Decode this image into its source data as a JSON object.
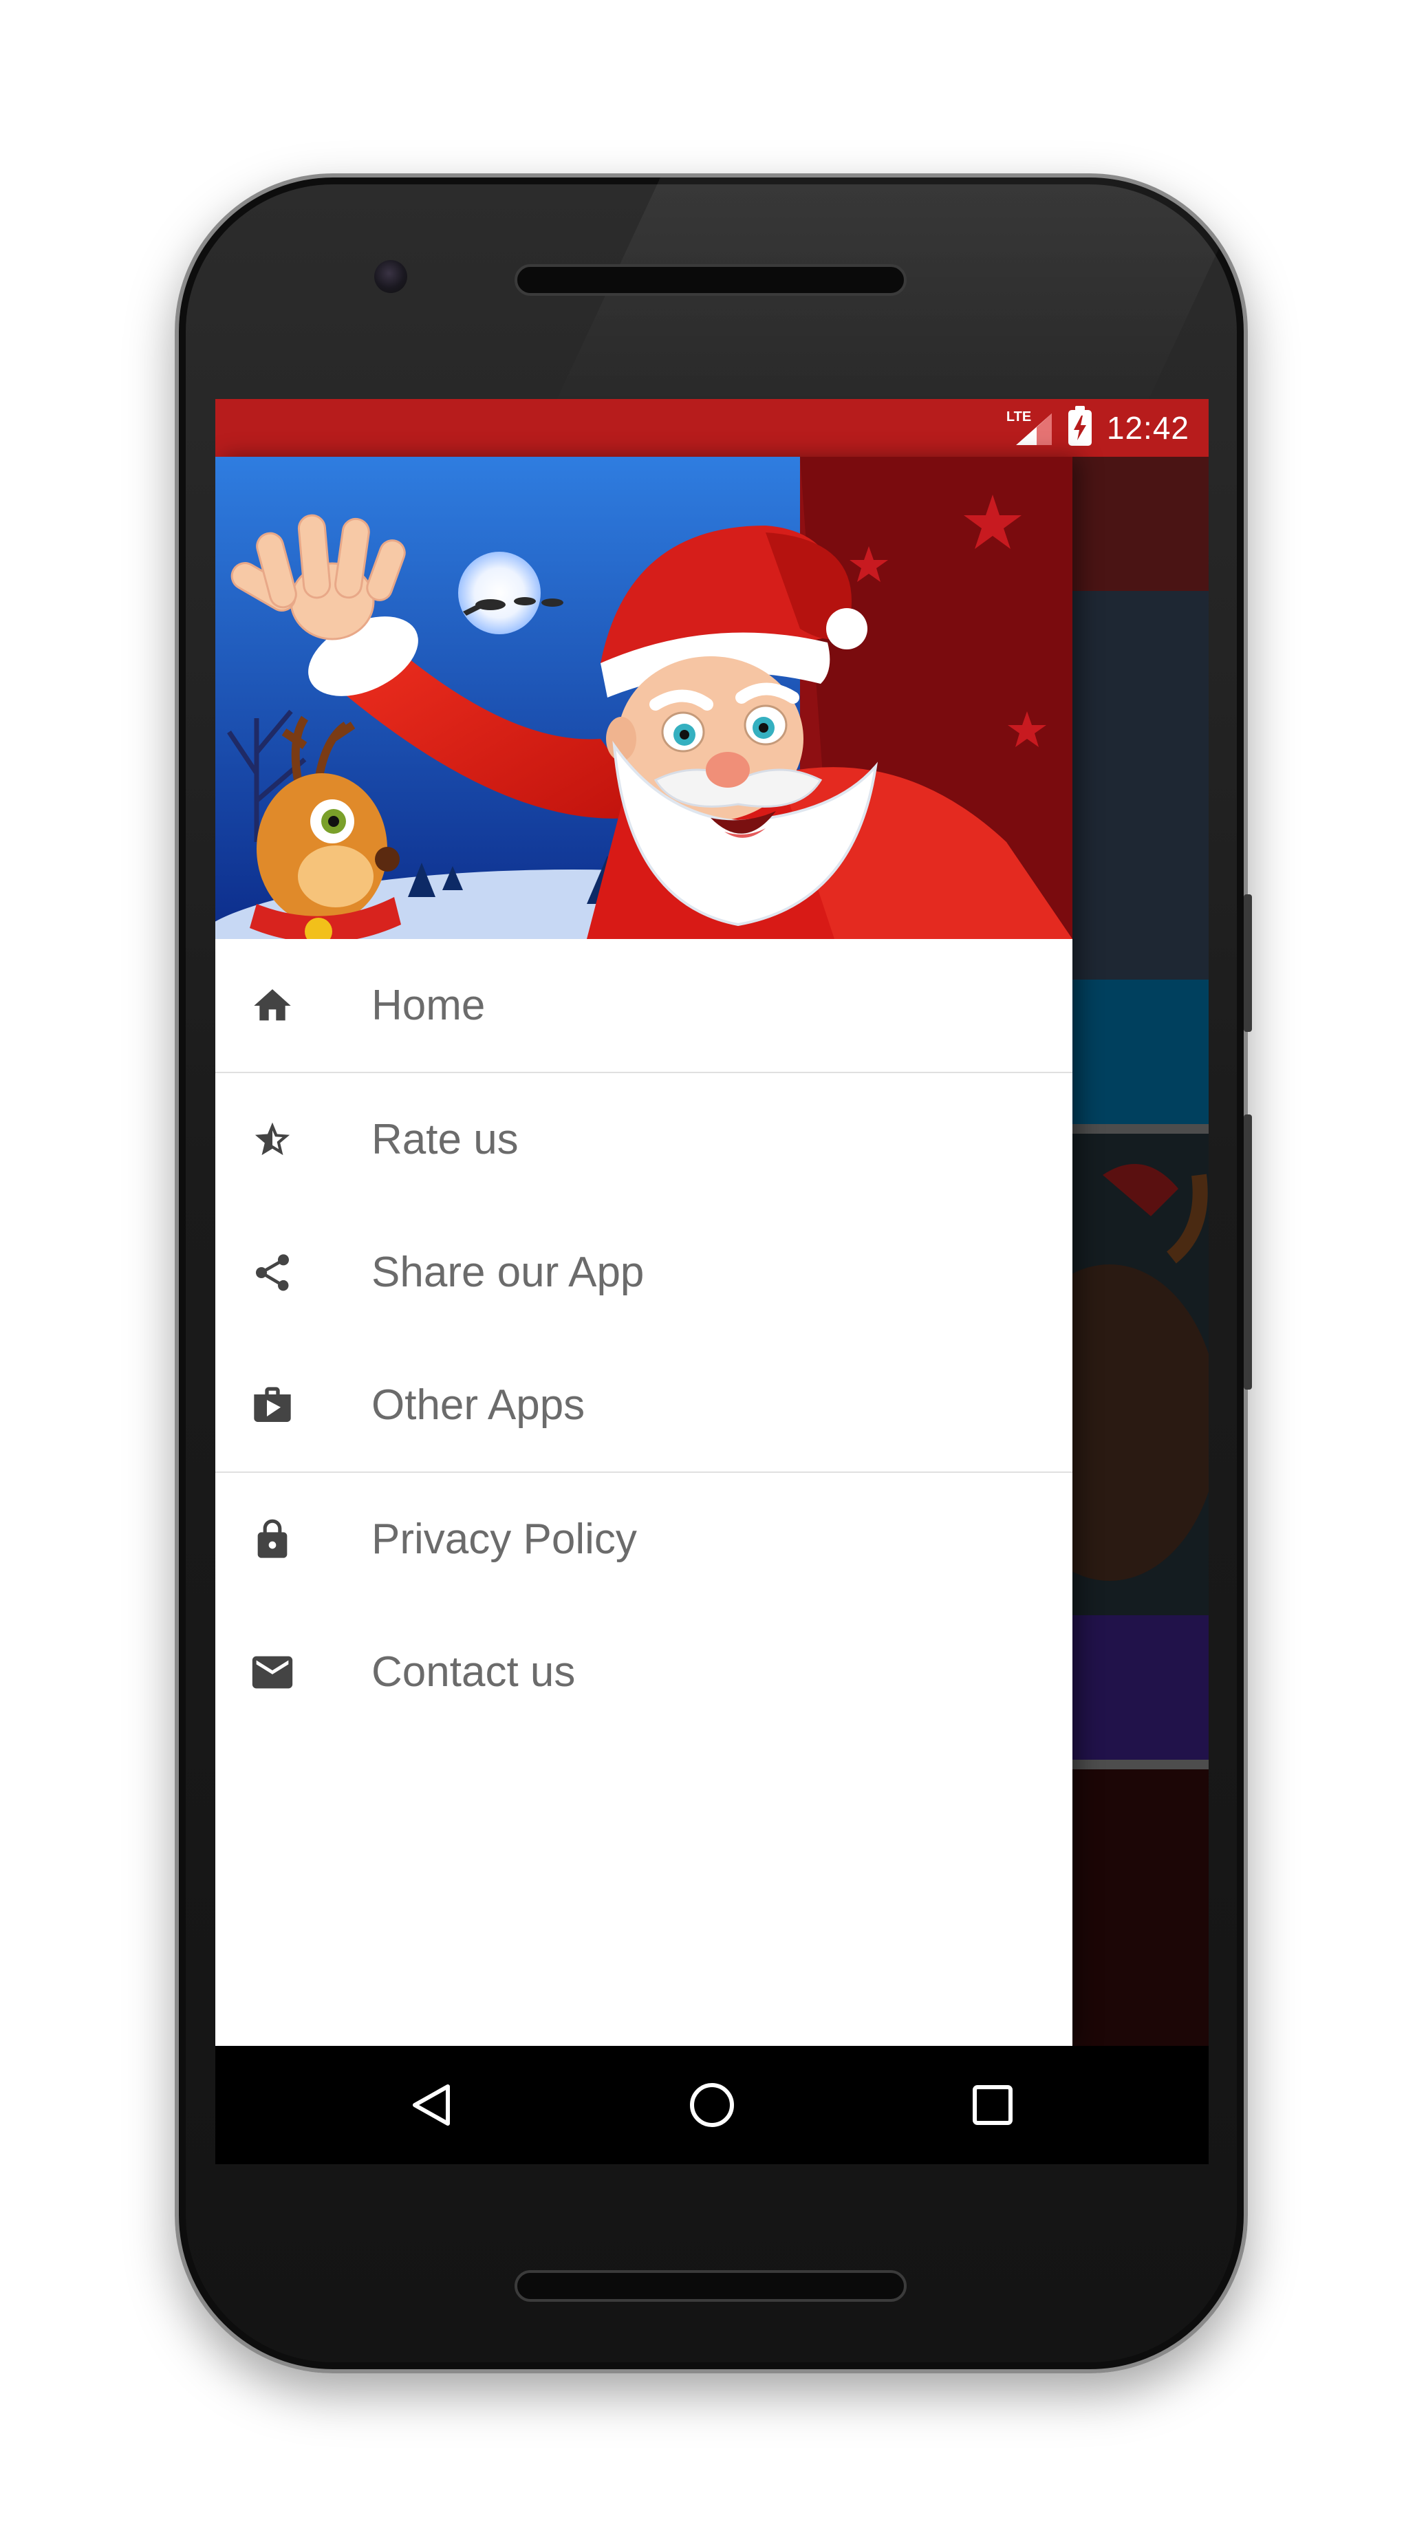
{
  "status_bar": {
    "network": "LTE",
    "time": "12:42",
    "background_color": "#b71c1c"
  },
  "drawer": {
    "menu": [
      {
        "label": "Home",
        "icon": "home-icon"
      },
      {
        "label": "Rate us",
        "icon": "star-icon"
      },
      {
        "label": "Share our App",
        "icon": "share-icon"
      },
      {
        "label": "Other Apps",
        "icon": "shop-bag-icon"
      },
      {
        "label": "Privacy Policy",
        "icon": "lock-icon"
      },
      {
        "label": "Contact us",
        "icon": "mail-icon"
      }
    ]
  },
  "nav_bar": {
    "icons": [
      "back-triangle-icon",
      "home-circle-icon",
      "recents-square-icon"
    ]
  },
  "colors": {
    "label_text": "#6b6b6b",
    "icon": "#444444",
    "divider": "#e0e0e0"
  }
}
